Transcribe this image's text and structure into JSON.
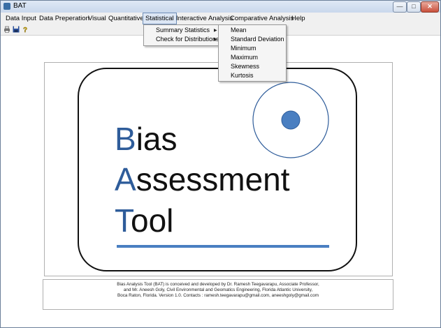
{
  "window": {
    "title": "BAT"
  },
  "menubar": {
    "items": [
      "Data Input",
      "Data Preperation",
      "Visual",
      "Quantitative",
      "Statistical",
      "Interactive Analysis",
      "Comparative Analysis",
      "Help"
    ],
    "active": "Statistical"
  },
  "statistical_menu": {
    "items": [
      "Summary Statistics",
      "Check for Distributions"
    ]
  },
  "summary_submenu": {
    "items": [
      "Mean",
      "Standard Deviation",
      "Minimum",
      "Maximum",
      "Skewness",
      "Kurtosis"
    ]
  },
  "logo": {
    "line1_initial": "B",
    "line1_rest": "ias",
    "line2_initial": "A",
    "line2_rest": "ssessment",
    "line3_initial": "T",
    "line3_rest": "ool",
    "accent_color": "#2e5c9a",
    "circle_fill": "#4a7fc1"
  },
  "credits": {
    "line1": "Bias Analysis Tool (BAT)  is conceived and developed by Dr. Ramesh Teegavarapu, Associate Professor,",
    "line2": "and Mr. Aneesh Goly, Civil Environmental and Geomatics Engineering, Florida Atlantic University,",
    "line3": "Boca Raton, Florida. Version 1.0. Contacts : ramesh.teegavarapu@gmail.com, aneeshgoly@gmail.com"
  }
}
